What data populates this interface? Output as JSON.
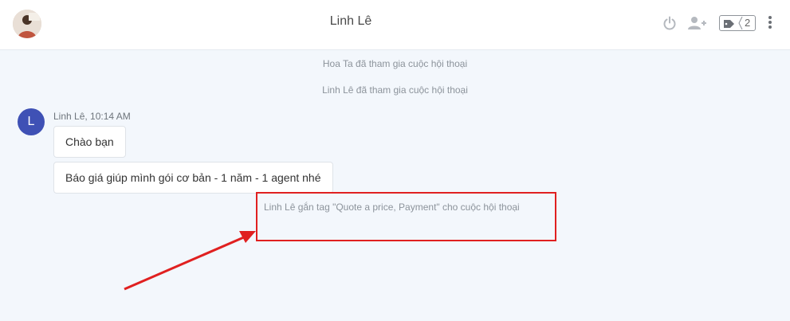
{
  "header": {
    "title": "Linh Lê",
    "tag_count": "2"
  },
  "messages": {
    "system_1": "Hoa Ta đã tham gia cuộc hội thoại",
    "system_2": "Linh Lê đã tham gia cuộc hội thoại",
    "avatar_letter": "L",
    "sender": "Linh Lê, 10:14 AM",
    "bubble_1": "Chào bạn",
    "bubble_2": "Báo giá giúp mình gói cơ bản - 1 năm - 1 agent nhé",
    "tag_notice": "Linh Lê gắn tag \"Quote a price, Payment\" cho cuộc hội thoại"
  },
  "colors": {
    "accent_avatar": "#3f51b5",
    "annotation_red": "#e02020",
    "background": "#f3f7fc"
  },
  "icons": [
    "power-icon",
    "add-user-icon",
    "tag-icon",
    "more-vertical-icon"
  ]
}
